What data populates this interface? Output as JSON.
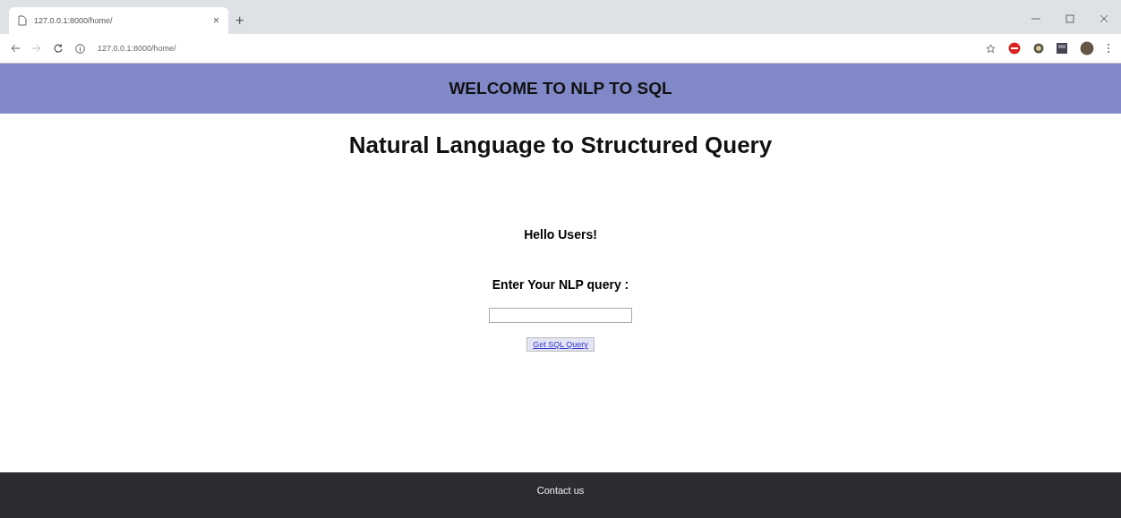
{
  "browser": {
    "tab": {
      "title": "127.0.0.1:8000/home/",
      "close": "×",
      "new_tab": "+"
    },
    "address": "127.0.0.1:8000/home/"
  },
  "header": {
    "title": "WELCOME TO NLP TO SQL"
  },
  "heading": "Natural Language to Structured Query",
  "greeting": "Hello Users!",
  "form": {
    "label": "Enter Your NLP query :",
    "button": "Get SQL Query"
  },
  "footer": {
    "link": "Contact us"
  }
}
